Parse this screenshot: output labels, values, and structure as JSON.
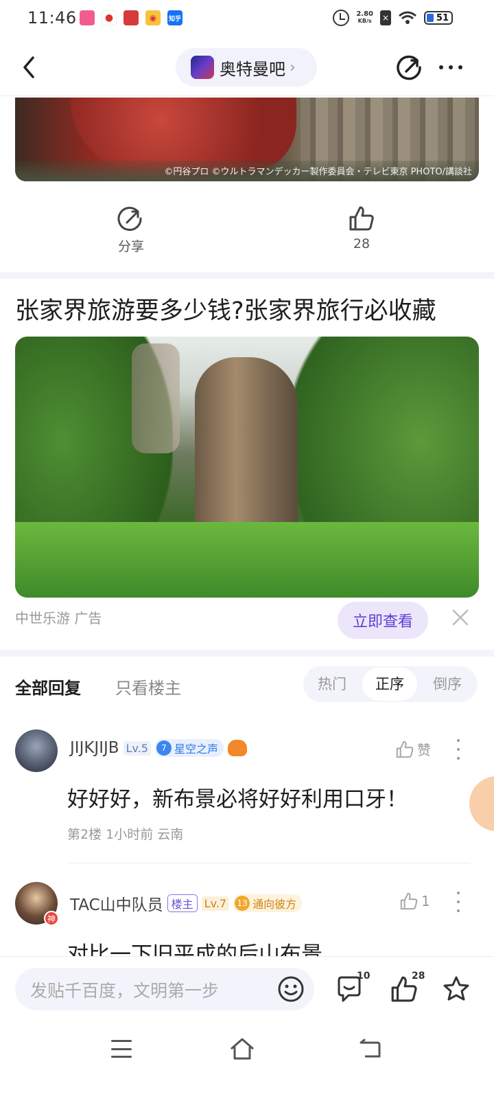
{
  "status_bar": {
    "time": "11:46",
    "net_speed_value": "2.80",
    "net_speed_unit": "KB/s",
    "battery": "51",
    "notif_icons": [
      {
        "name": "bilibili-icon",
        "color": "#f25d8e"
      },
      {
        "name": "balloon-icon",
        "color": "#ffffff"
      },
      {
        "name": "app-red-icon",
        "color": "#d63b3b"
      },
      {
        "name": "weibo-icon",
        "color": "#f8c23d"
      },
      {
        "name": "zhihu-icon",
        "color": "#1772f6",
        "text": "知乎"
      }
    ]
  },
  "nav": {
    "forum_name": "奥特曼吧",
    "chevron": "›"
  },
  "top_image": {
    "copyright": "©円谷プロ ©ウルトラマンデッカー製作委員会・テレビ東京 PHOTO/講談社"
  },
  "post_actions": {
    "share_label": "分享",
    "like_count": "28"
  },
  "ad": {
    "title": "张家界旅游要多少钱?张家界旅行必收藏",
    "source": "中世乐游  广告",
    "view_button": "立即查看"
  },
  "tabs": {
    "all": "全部回复",
    "op_only": "只看楼主",
    "sort_hot": "热门",
    "sort_asc": "正序",
    "sort_desc": "倒序"
  },
  "comments": [
    {
      "user": "JIJKJIJB",
      "level": "Lv.5",
      "title_num": "7",
      "title": "星空之声",
      "like_label": "赞",
      "text": "好好好，新布景必将好好利用口牙！",
      "meta": "第2楼  1小时前  云南"
    },
    {
      "user": "TAC山中队员",
      "god_badge": "神",
      "op_badge": "楼主",
      "level": "Lv.7",
      "title_num": "13",
      "title": "通向彼方",
      "like_count": "1",
      "text": "对比一下旧平成的后山布景"
    }
  ],
  "bottom_bar": {
    "placeholder": "发贴千百度，文明第一步",
    "reply_count": "10",
    "like_count": "28"
  },
  "colors": {
    "accent": "#5b3fd0",
    "ad_button_bg": "#ece6fb",
    "band": "#f3f4fb"
  }
}
